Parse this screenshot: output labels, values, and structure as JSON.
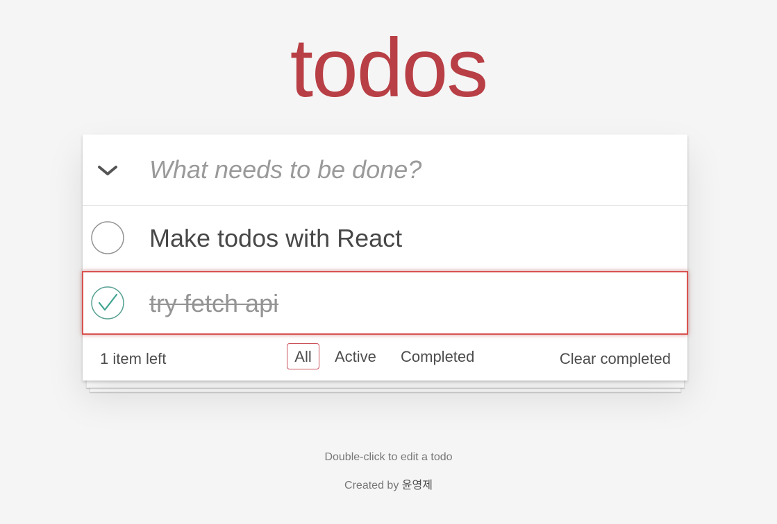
{
  "app": {
    "title": "todos",
    "accent_color": "#b83f45"
  },
  "new_todo": {
    "placeholder": "What needs to be done?",
    "value": ""
  },
  "toggle_all": {
    "icon": "chevron-down-icon"
  },
  "todos": [
    {
      "label": "Make todos with React",
      "completed": false
    },
    {
      "label": "try fetch api",
      "completed": true
    }
  ],
  "footer": {
    "count_text": "1 item left",
    "filters": [
      "All",
      "Active",
      "Completed"
    ],
    "selected_filter": "All",
    "clear_completed_label": "Clear completed"
  },
  "info": {
    "edit_hint": "Double-click to edit a todo",
    "credit_prefix": "Created by",
    "author": "윤영제"
  }
}
